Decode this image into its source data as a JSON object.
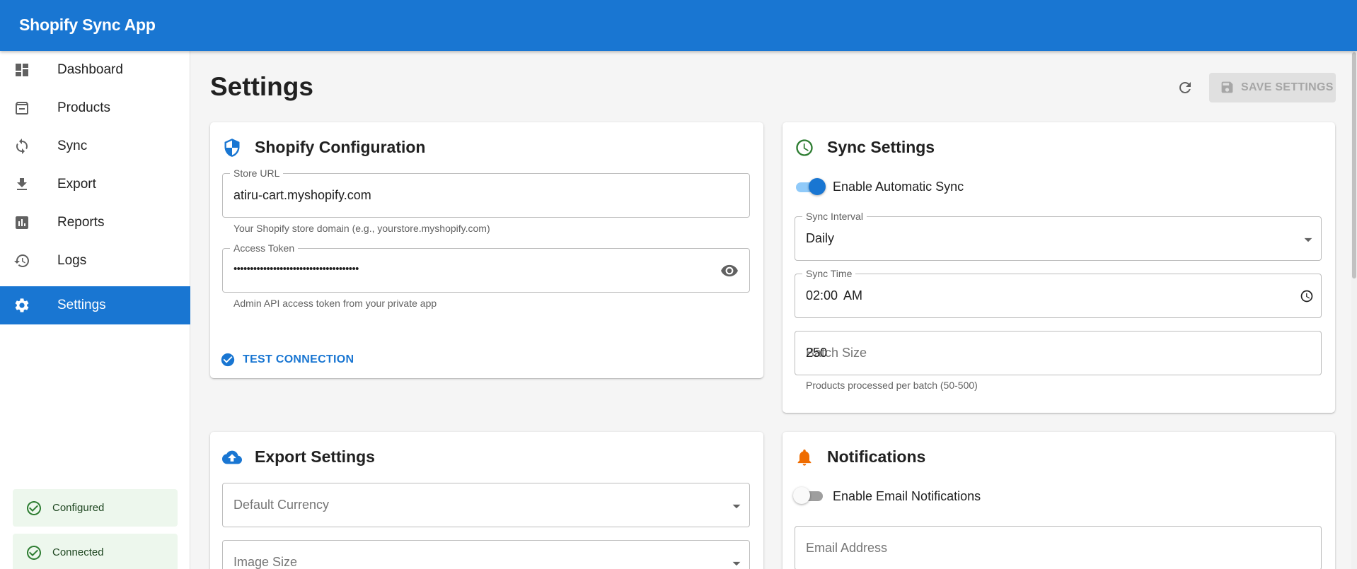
{
  "app": {
    "title": "Shopify Sync App"
  },
  "sidebar": {
    "items": [
      {
        "label": "Dashboard",
        "icon": "dashboard-icon"
      },
      {
        "label": "Products",
        "icon": "archive-icon"
      },
      {
        "label": "Sync",
        "icon": "sync-icon"
      },
      {
        "label": "Export",
        "icon": "download-icon"
      },
      {
        "label": "Reports",
        "icon": "bar-chart-icon"
      },
      {
        "label": "Logs",
        "icon": "history-icon"
      },
      {
        "label": "Settings",
        "icon": "gear-icon",
        "active": true
      }
    ],
    "status": [
      {
        "label": "Configured",
        "icon": "check-circle-icon"
      },
      {
        "label": "Connected",
        "icon": "check-circle-icon"
      }
    ]
  },
  "header": {
    "title": "Settings",
    "save_label": "SAVE SETTINGS"
  },
  "shopify": {
    "title": "Shopify Configuration",
    "store_url": {
      "label": "Store URL",
      "value": "atiru-cart.myshopify.com",
      "helper": "Your Shopify store domain (e.g., yourstore.myshopify.com)"
    },
    "access_token": {
      "label": "Access Token",
      "value": "••••••••••••••••••••••••••••••••••••••",
      "helper": "Admin API access token from your private app"
    },
    "test_label": "TEST CONNECTION"
  },
  "sync": {
    "title": "Sync Settings",
    "auto_sync": {
      "label": "Enable Automatic Sync",
      "enabled": true
    },
    "interval": {
      "label": "Sync Interval",
      "value": "Daily"
    },
    "time": {
      "label": "Sync Time",
      "value": "02:00 AM"
    },
    "batch": {
      "value": "250",
      "label_overlap": "Batch Size",
      "helper": "Products processed per batch (50-500)"
    }
  },
  "export": {
    "title": "Export Settings",
    "currency_placeholder": "Default Currency",
    "image_size_placeholder": "Image Size"
  },
  "notifications": {
    "title": "Notifications",
    "email_toggle": {
      "label": "Enable Email Notifications",
      "enabled": false
    },
    "email_placeholder": "Email Address"
  },
  "colors": {
    "primary": "#1976d2",
    "success": "#2e7d32",
    "warning": "#ef6c00",
    "background": "#f5f5f5"
  }
}
